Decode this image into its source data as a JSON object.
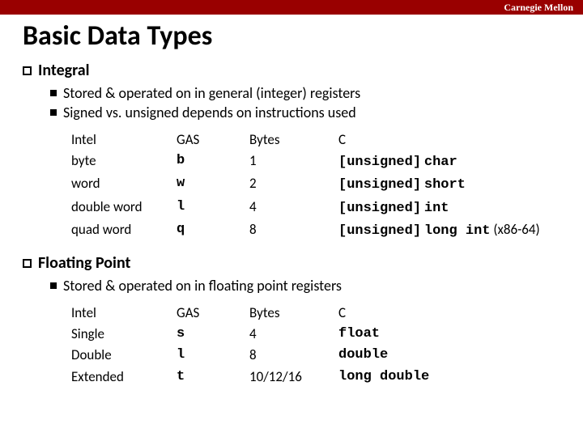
{
  "header": {
    "org": "Carnegie Mellon"
  },
  "title": "Basic Data Types",
  "integral": {
    "heading": "Integral",
    "bullets": [
      "Stored & operated on in general (integer) registers",
      "Signed vs. unsigned depends on instructions used"
    ],
    "cols": {
      "c1": "Intel",
      "c2": "GAS",
      "c3": "Bytes",
      "c4": "C"
    },
    "rows": [
      {
        "intel": "byte",
        "gas": "b",
        "bytes": "1",
        "prefix": "[unsigned]",
        "ctype": "char",
        "note": ""
      },
      {
        "intel": "word",
        "gas": "w",
        "bytes": "2",
        "prefix": "[unsigned]",
        "ctype": "short",
        "note": ""
      },
      {
        "intel": "double word",
        "gas": "l",
        "bytes": "4",
        "prefix": "[unsigned]",
        "ctype": "int",
        "note": ""
      },
      {
        "intel": "quad word",
        "gas": "q",
        "bytes": "8",
        "prefix": "[unsigned]",
        "ctype": "long int",
        "note": "(x86-64)"
      }
    ]
  },
  "float": {
    "heading": "Floating Point",
    "bullets": [
      "Stored & operated on in floating point registers"
    ],
    "cols": {
      "c1": "Intel",
      "c2": "GAS",
      "c3": "Bytes",
      "c4": "C"
    },
    "rows": [
      {
        "intel": "Single",
        "gas": "s",
        "bytes": "4",
        "ctype": "float"
      },
      {
        "intel": "Double",
        "gas": "l",
        "bytes": "8",
        "ctype": "double"
      },
      {
        "intel": "Extended",
        "gas": "t",
        "bytes": "10/12/16",
        "ctype": "long double"
      }
    ]
  }
}
